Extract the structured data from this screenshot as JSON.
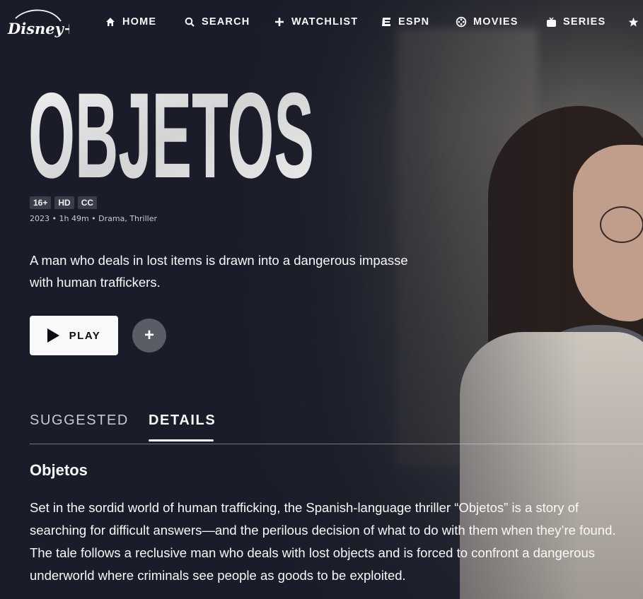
{
  "nav": {
    "logo_text": "Disney+",
    "items": [
      {
        "label": "HOME",
        "icon": "home-icon"
      },
      {
        "label": "SEARCH",
        "icon": "search-icon"
      },
      {
        "label": "WATCHLIST",
        "icon": "plus-icon"
      },
      {
        "label": "ESPN",
        "icon": "espn-icon"
      },
      {
        "label": "MOVIES",
        "icon": "movies-icon"
      },
      {
        "label": "SERIES",
        "icon": "series-icon"
      },
      {
        "label": "",
        "icon": "star-icon"
      }
    ]
  },
  "hero": {
    "title": "OBJETOS",
    "badges": [
      "16+",
      "HD",
      "CC"
    ],
    "meta": "2023 • 1h 49m • Drama, Thriller",
    "description": "A man who deals in lost items is drawn into a dangerous impasse with human traffickers.",
    "play_label": "PLAY",
    "add_label": "+"
  },
  "tabs": [
    {
      "label": "SUGGESTED",
      "active": false
    },
    {
      "label": "DETAILS",
      "active": true
    }
  ],
  "details": {
    "title": "Objetos",
    "text": "Set in the sordid world of human trafficking, the Spanish-language thriller “Objetos” is a story of searching for difficult answers—and the perilous decision of what to do with them when they’re found. The tale follows a reclusive man who deals with lost objects and is forced to confront a dangerous underworld where criminals see people as goods to be exploited."
  },
  "colors": {
    "background": "#1a1d29",
    "text": "#f9f9f9",
    "play_button": "#f9f9f9",
    "add_button": "#5a5c66"
  }
}
